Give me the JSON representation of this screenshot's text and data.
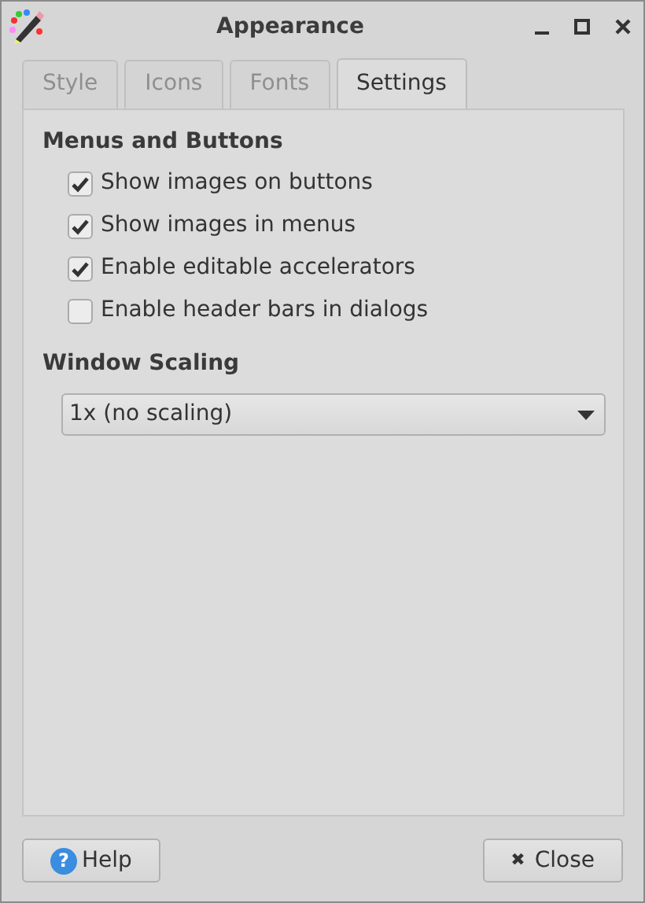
{
  "window": {
    "title": "Appearance"
  },
  "tabs": [
    {
      "label": "Style",
      "selected": false
    },
    {
      "label": "Icons",
      "selected": false
    },
    {
      "label": "Fonts",
      "selected": false
    },
    {
      "label": "Settings",
      "selected": true
    }
  ],
  "sections": [
    {
      "heading": "Menus and Buttons",
      "options": [
        {
          "label": "Show images on buttons",
          "checked": true
        },
        {
          "label": "Show images in menus",
          "checked": true
        },
        {
          "label": "Enable editable accelerators",
          "checked": true
        },
        {
          "label": "Enable header bars in dialogs",
          "checked": false
        }
      ]
    },
    {
      "heading": "Window Scaling",
      "dropdown": {
        "value": "1x (no scaling)"
      }
    }
  ],
  "buttons": [
    {
      "kind": "help",
      "icon": "?",
      "label": "Help"
    },
    {
      "kind": "close",
      "icon": "✖",
      "label": "Close"
    }
  ]
}
